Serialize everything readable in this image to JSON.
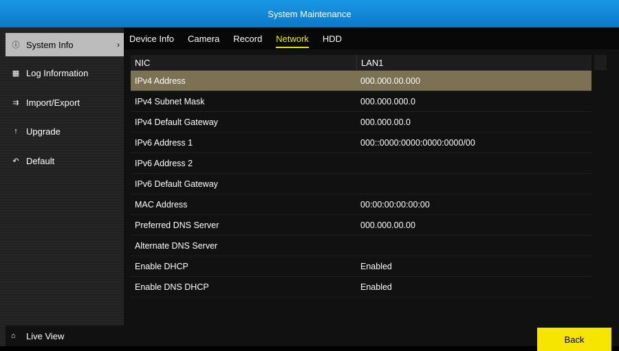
{
  "window": {
    "title": "System Maintenance"
  },
  "sidebar": {
    "items": [
      {
        "label": "System Info",
        "icon": "info-icon"
      },
      {
        "label": "Log Information",
        "icon": "log-icon"
      },
      {
        "label": "Import/Export",
        "icon": "import-export-icon"
      },
      {
        "label": "Upgrade",
        "icon": "upgrade-icon"
      },
      {
        "label": "Default",
        "icon": "default-icon"
      }
    ],
    "live_view": "Live View"
  },
  "tabs": [
    {
      "label": "Device Info"
    },
    {
      "label": "Camera"
    },
    {
      "label": "Record"
    },
    {
      "label": "Network"
    },
    {
      "label": "HDD"
    }
  ],
  "table": {
    "headers": [
      "NIC",
      "LAN1"
    ],
    "rows": [
      {
        "name": "IPv4 Address",
        "value": "000.000.00.000"
      },
      {
        "name": "IPv4 Subnet Mask",
        "value": "000.000.000.0"
      },
      {
        "name": "IPv4 Default Gateway",
        "value": "000.000.00.0"
      },
      {
        "name": "IPv6 Address 1",
        "value": "000::0000:0000:0000:0000/00"
      },
      {
        "name": "IPv6 Address 2",
        "value": ""
      },
      {
        "name": "IPv6 Default Gateway",
        "value": ""
      },
      {
        "name": "MAC Address",
        "value": "00:00:00:00:00:00"
      },
      {
        "name": "Preferred DNS Server",
        "value": "000.000.00.00"
      },
      {
        "name": "Alternate DNS Server",
        "value": ""
      },
      {
        "name": "Enable DHCP",
        "value": "Enabled"
      },
      {
        "name": "Enable DNS DHCP",
        "value": "Enabled"
      }
    ]
  },
  "buttons": {
    "back": "Back"
  },
  "colors": {
    "accent": "#f5e500",
    "title_bar": "#1a98e6",
    "selected_row": "#7c7152"
  }
}
